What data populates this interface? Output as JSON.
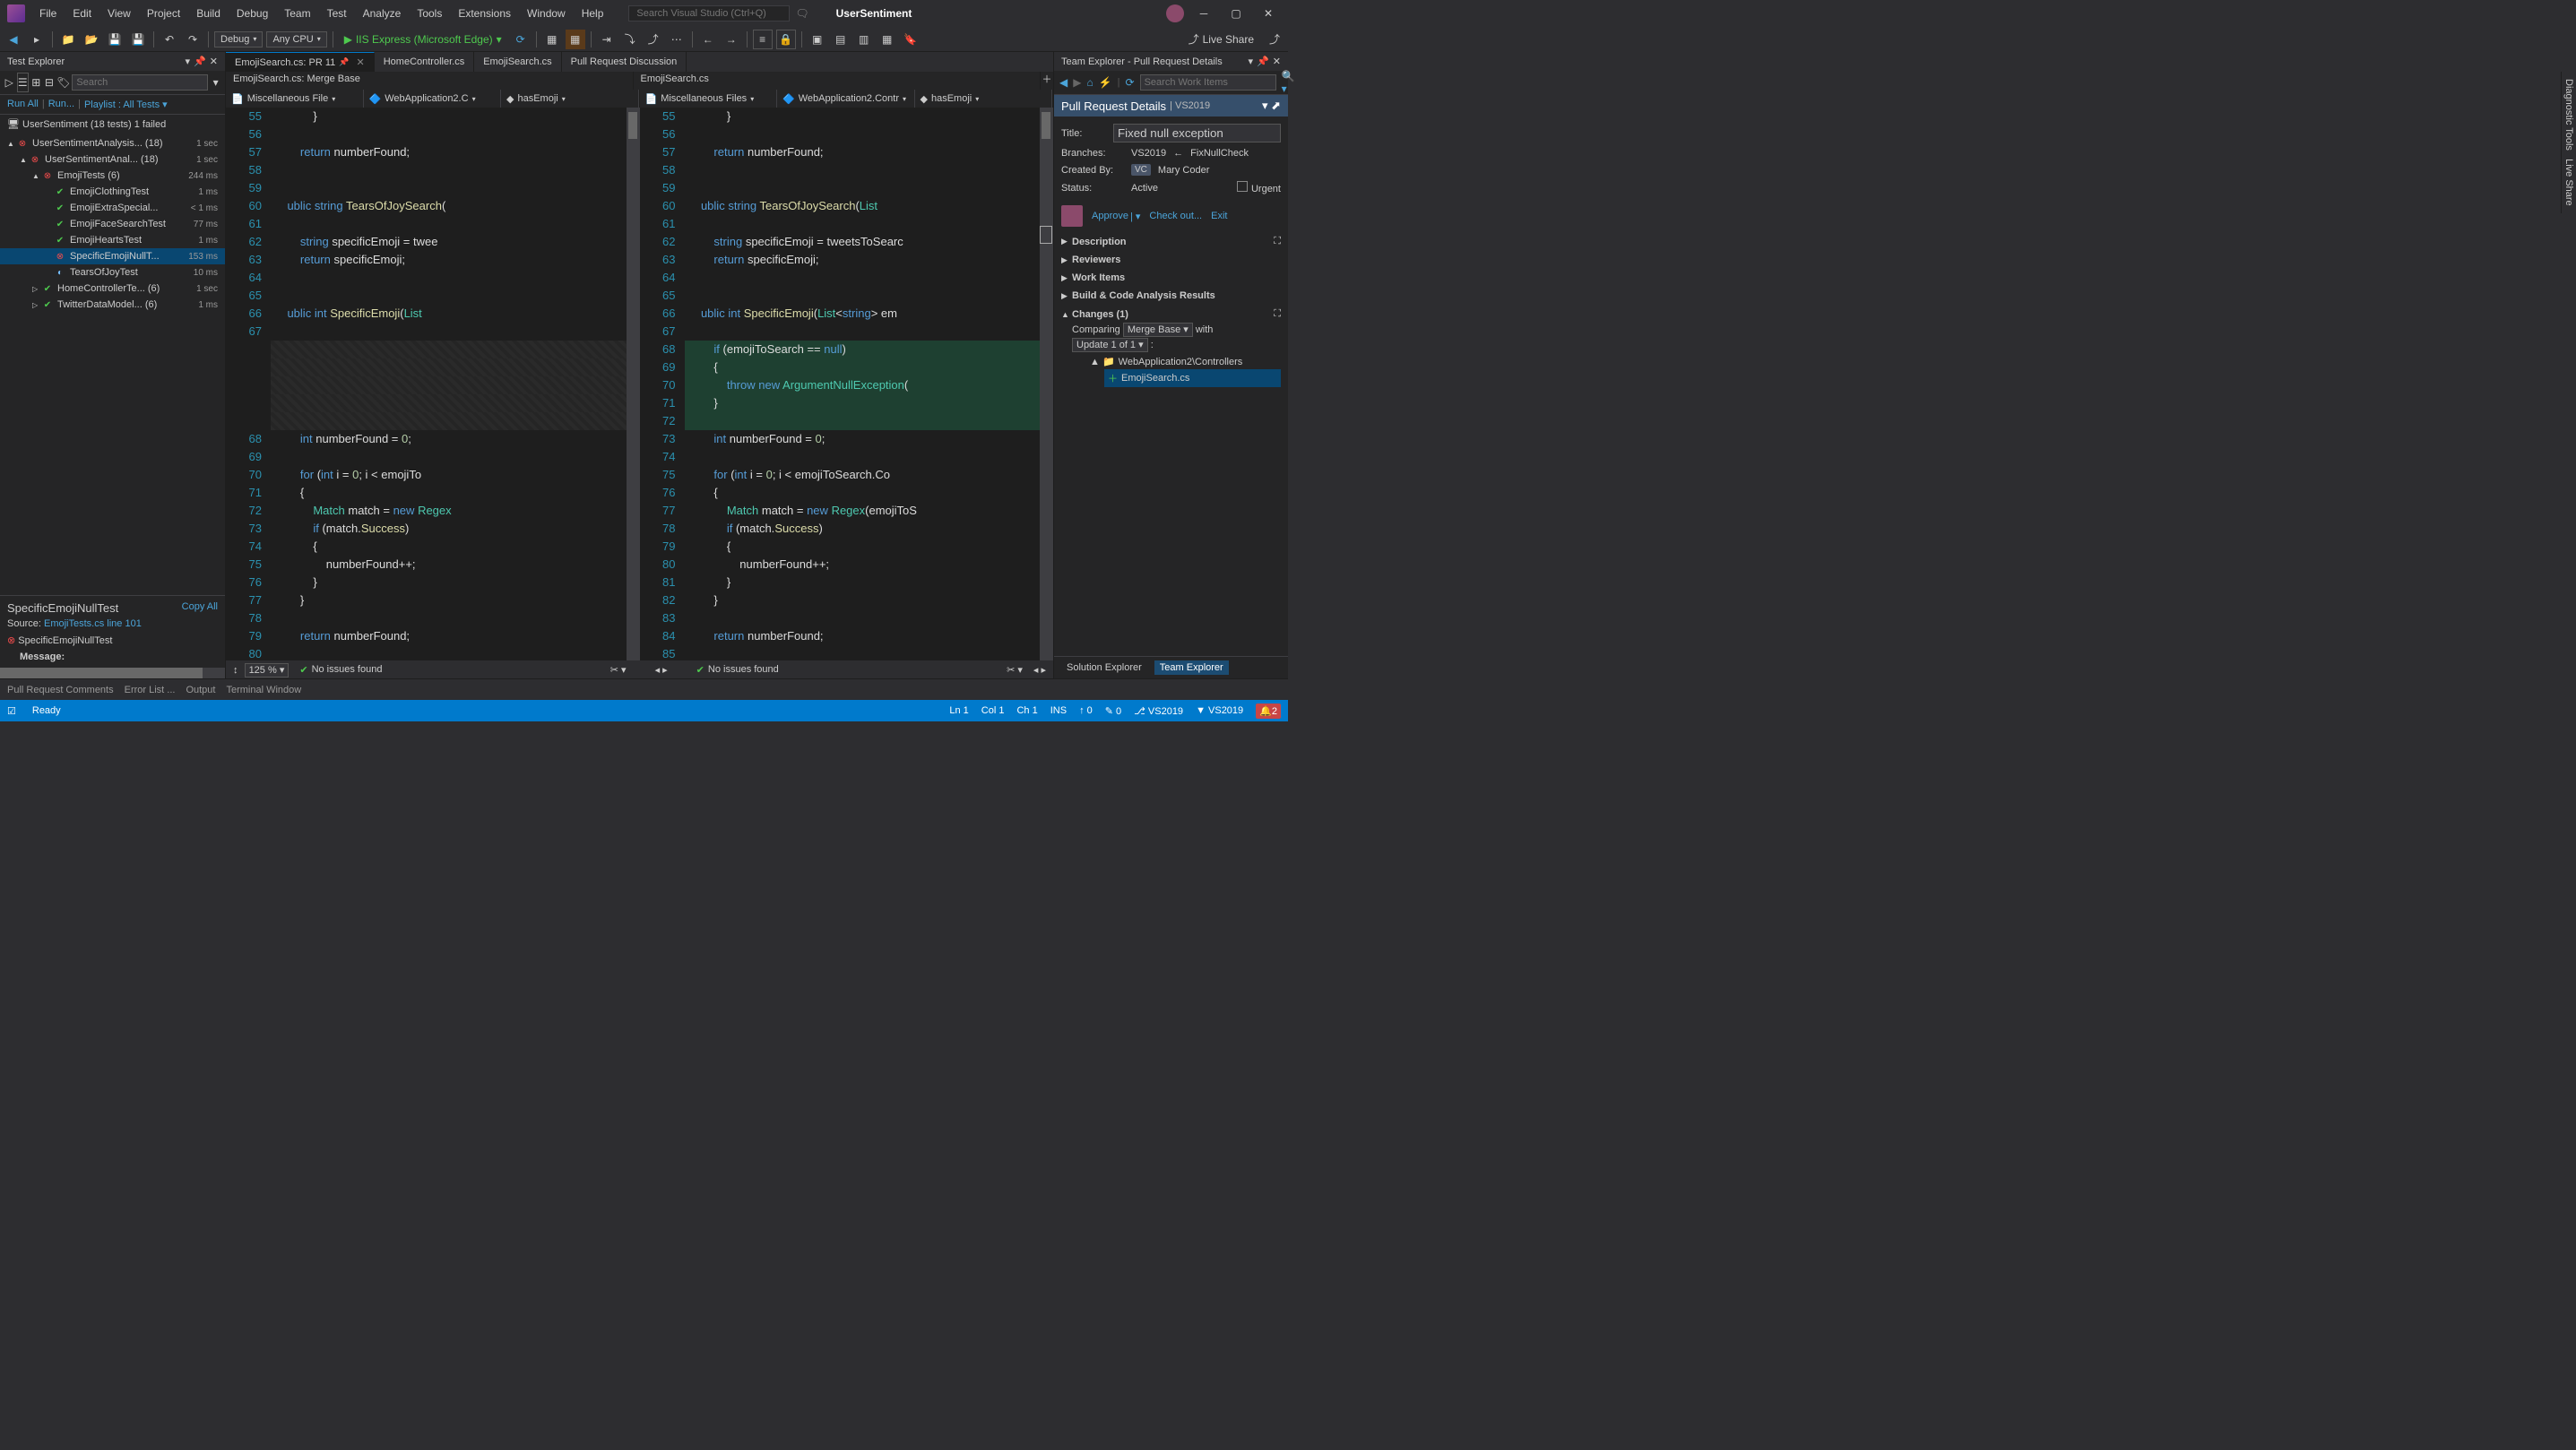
{
  "menu": [
    "File",
    "Edit",
    "View",
    "Project",
    "Build",
    "Debug",
    "Team",
    "Test",
    "Analyze",
    "Tools",
    "Extensions",
    "Window",
    "Help"
  ],
  "search_vs_placeholder": "Search Visual Studio (Ctrl+Q)",
  "solution_name": "UserSentiment",
  "toolbar": {
    "config": "Debug",
    "platform": "Any CPU",
    "run_label": "IIS Express (Microsoft Edge)",
    "live_share": "Live Share"
  },
  "test_explorer": {
    "title": "Test Explorer",
    "search_placeholder": "Search",
    "links": {
      "run_all": "Run All",
      "run": "Run...",
      "playlist": "Playlist : All Tests"
    },
    "summary": "UserSentiment (18 tests) 1 failed",
    "nodes": [
      {
        "indent": 0,
        "exp": "▲",
        "status": "fail",
        "name": "UserSentimentAnalysis... (18)",
        "time": "1 sec"
      },
      {
        "indent": 1,
        "exp": "▲",
        "status": "fail",
        "name": "UserSentimentAnal... (18)",
        "time": "1 sec"
      },
      {
        "indent": 2,
        "exp": "▲",
        "status": "fail",
        "name": "EmojiTests (6)",
        "time": "244 ms"
      },
      {
        "indent": 3,
        "exp": "",
        "status": "pass",
        "name": "EmojiClothingTest",
        "time": "1 ms"
      },
      {
        "indent": 3,
        "exp": "",
        "status": "pass",
        "name": "EmojiExtraSpecial...",
        "time": "< 1 ms"
      },
      {
        "indent": 3,
        "exp": "",
        "status": "pass",
        "name": "EmojiFaceSearchTest",
        "time": "77 ms"
      },
      {
        "indent": 3,
        "exp": "",
        "status": "pass",
        "name": "EmojiHeartsTest",
        "time": "1 ms"
      },
      {
        "indent": 3,
        "exp": "",
        "status": "fail",
        "name": "SpecificEmojiNullT...",
        "time": "153 ms",
        "selected": true
      },
      {
        "indent": 3,
        "exp": "",
        "status": "skip",
        "name": "TearsOfJoyTest",
        "time": "10 ms"
      },
      {
        "indent": 2,
        "exp": "▷",
        "status": "pass",
        "name": "HomeControllerTe... (6)",
        "time": "1 sec"
      },
      {
        "indent": 2,
        "exp": "▷",
        "status": "pass",
        "name": "TwitterDataModel... (6)",
        "time": "1 ms"
      }
    ],
    "detail": {
      "title": "SpecificEmojiNullTest",
      "copy": "Copy All",
      "source_label": "Source:",
      "source_link": "EmojiTests.cs line 101",
      "fail_name": "SpecificEmojiNullTest",
      "message_label": "Message:"
    }
  },
  "tabs": [
    {
      "label": "EmojiSearch.cs: PR 11",
      "active": true,
      "pinned": true,
      "closable": true
    },
    {
      "label": "HomeController.cs"
    },
    {
      "label": "EmojiSearch.cs"
    },
    {
      "label": "Pull Request Discussion"
    }
  ],
  "diff_titles": {
    "left": "EmojiSearch.cs: Merge Base",
    "right": "EmojiSearch.cs"
  },
  "nav": {
    "left": {
      "project": "Miscellaneous File",
      "class": "WebApplication2.C",
      "member": "hasEmoji"
    },
    "right": {
      "project": "Miscellaneous Files",
      "class": "WebApplication2.Contr",
      "member": "hasEmoji"
    }
  },
  "code_left": [
    {
      "n": 55,
      "t": "            }"
    },
    {
      "n": 56,
      "t": ""
    },
    {
      "n": 57,
      "t": "        return numberFound;"
    },
    {
      "n": 58,
      "t": ""
    },
    {
      "n": 59,
      "t": ""
    },
    {
      "n": 60,
      "t": "    ublic string TearsOfJoySearch("
    },
    {
      "n": 61,
      "t": ""
    },
    {
      "n": 62,
      "t": "        string specificEmoji = twee"
    },
    {
      "n": 63,
      "t": "        return specificEmoji;"
    },
    {
      "n": 64,
      "t": ""
    },
    {
      "n": 65,
      "t": ""
    },
    {
      "n": 66,
      "t": "    ublic int SpecificEmoji(List<s"
    },
    {
      "n": 67,
      "t": ""
    },
    {
      "n": "",
      "t": "",
      "diff": "removed"
    },
    {
      "n": "",
      "t": "",
      "diff": "removed"
    },
    {
      "n": "",
      "t": "",
      "diff": "removed"
    },
    {
      "n": "",
      "t": "",
      "diff": "removed"
    },
    {
      "n": "",
      "t": "",
      "diff": "removed"
    },
    {
      "n": 68,
      "t": "        int numberFound = 0;"
    },
    {
      "n": 69,
      "t": ""
    },
    {
      "n": 70,
      "t": "        for (int i = 0; i < emojiTo"
    },
    {
      "n": 71,
      "t": "        {"
    },
    {
      "n": 72,
      "t": "            Match match = new Regex"
    },
    {
      "n": 73,
      "t": "            if (match.Success)"
    },
    {
      "n": 74,
      "t": "            {"
    },
    {
      "n": 75,
      "t": "                numberFound++;"
    },
    {
      "n": 76,
      "t": "            }"
    },
    {
      "n": 77,
      "t": "        }"
    },
    {
      "n": 78,
      "t": ""
    },
    {
      "n": 79,
      "t": "        return numberFound;"
    },
    {
      "n": 80,
      "t": ""
    }
  ],
  "code_right": [
    {
      "n": 55,
      "t": "            }"
    },
    {
      "n": 56,
      "t": ""
    },
    {
      "n": 57,
      "t": "        return numberFound;"
    },
    {
      "n": 58,
      "t": ""
    },
    {
      "n": 59,
      "t": ""
    },
    {
      "n": 60,
      "t": "    ublic string TearsOfJoySearch(List<stri"
    },
    {
      "n": 61,
      "t": ""
    },
    {
      "n": 62,
      "t": "        string specificEmoji = tweetsToSearc"
    },
    {
      "n": 63,
      "t": "        return specificEmoji;"
    },
    {
      "n": 64,
      "t": ""
    },
    {
      "n": 65,
      "t": ""
    },
    {
      "n": 66,
      "t": "    ublic int SpecificEmoji(List<string> em"
    },
    {
      "n": 67,
      "t": ""
    },
    {
      "n": 68,
      "t": "        if (emojiToSearch == null)",
      "diff": "added"
    },
    {
      "n": 69,
      "t": "        {",
      "diff": "added"
    },
    {
      "n": 70,
      "t": "            throw new ArgumentNullException(",
      "diff": "added"
    },
    {
      "n": 71,
      "t": "        }",
      "diff": "added"
    },
    {
      "n": 72,
      "t": "",
      "diff": "added"
    },
    {
      "n": 73,
      "t": "        int numberFound = 0;"
    },
    {
      "n": 74,
      "t": ""
    },
    {
      "n": 75,
      "t": "        for (int i = 0; i < emojiToSearch.Co"
    },
    {
      "n": 76,
      "t": "        {"
    },
    {
      "n": 77,
      "t": "            Match match = new Regex(emojiToS"
    },
    {
      "n": 78,
      "t": "            if (match.Success)"
    },
    {
      "n": 79,
      "t": "            {"
    },
    {
      "n": 80,
      "t": "                numberFound++;"
    },
    {
      "n": 81,
      "t": "            }"
    },
    {
      "n": 82,
      "t": "        }"
    },
    {
      "n": 83,
      "t": ""
    },
    {
      "n": 84,
      "t": "        return numberFound;"
    },
    {
      "n": 85,
      "t": ""
    }
  ],
  "editor_status": {
    "zoom": "125 %",
    "no_issues": "No issues found"
  },
  "team_explorer": {
    "title": "Team Explorer - Pull Request Details",
    "search_placeholder": "Search Work Items",
    "header": "Pull Request Details",
    "header_sub": "| VS2019",
    "title_label": "Title:",
    "title_value": "Fixed null exception",
    "branches_label": "Branches:",
    "branch_target": "VS2019",
    "branch_source": "FixNullCheck",
    "created_by_label": "Created By:",
    "created_by_badge": "VC",
    "created_by_name": "Mary Coder",
    "status_label": "Status:",
    "status_value": "Active",
    "urgent_label": "Urgent",
    "approve": "Approve",
    "checkout": "Check out...",
    "exit": "Exit",
    "sections": [
      "Description",
      "Reviewers",
      "Work Items",
      "Build & Code Analysis Results"
    ],
    "changes_label": "Changes (1)",
    "comparing_label": "Comparing",
    "compare_base": "Merge Base",
    "compare_with": "with",
    "update_label": "Update 1 of 1",
    "folder": "WebApplication2\\Controllers",
    "file": "EmojiSearch.cs"
  },
  "solution_tabs": [
    "Solution Explorer",
    "Team Explorer"
  ],
  "output_tabs": [
    "Pull Request Comments",
    "Error List ...",
    "Output",
    "Terminal Window"
  ],
  "statusbar": {
    "ready": "Ready",
    "ln": "Ln 1",
    "col": "Col 1",
    "ch": "Ch 1",
    "ins": "INS",
    "up": "0",
    "pencil": "0",
    "branch": "VS2019",
    "repo": "VS2019",
    "notif": "2"
  },
  "side_tab_labels": [
    "Diagnostic Tools",
    "Live Share"
  ]
}
